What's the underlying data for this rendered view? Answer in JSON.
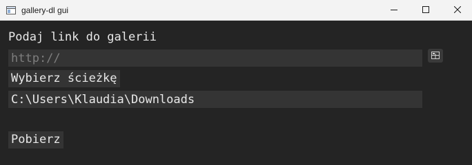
{
  "window": {
    "title": "gallery-dl gui"
  },
  "icons": {
    "app": "window-app-icon",
    "minimize": "minimize-icon",
    "maximize": "maximize-icon",
    "close": "close-icon",
    "paste": "paste-icon"
  },
  "form": {
    "link_label": "Podaj link do galerii",
    "link_placeholder": "http://",
    "link_value": "",
    "path_button_label": "Wybierz ścieżkę",
    "path_value": "C:\\Users\\Klaudia\\Downloads",
    "download_button_label": "Pobierz"
  },
  "colors": {
    "background": "#242424",
    "field_background": "#343434",
    "text": "#e8e8e8",
    "placeholder": "#7e7e7e",
    "titlebar": "#f3f3f3"
  }
}
